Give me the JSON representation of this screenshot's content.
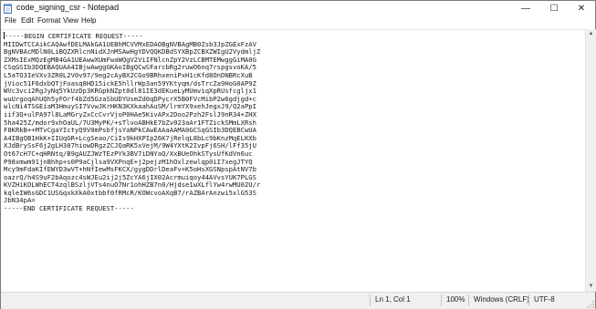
{
  "window": {
    "title": "code_signing_csr - Notepad",
    "controls": {
      "minimize_glyph": "—",
      "maximize_glyph": "☐",
      "close_glyph": "✕"
    }
  },
  "menu": {
    "items": [
      "File",
      "Edit",
      "Format",
      "View",
      "Help"
    ]
  },
  "editor": {
    "lines": [
      "-----BEGIN CERTIFICATE REQUEST-----",
      "MIIDwTCCAikCAQAwfDELMAkGA1UEBhMCVVMxEDAOBgNVBAgMB0Zsb3JpZGExFzAV",
      "BgNVBAcMDlN0LiBQZXRlcnNidXJnMSAwHgYDVQQKDBdSYXBpZCBXZWIgU2VydmljZ",
      "ZXMsIExMQzEgMB4GA1UEAwwXUmFwaWQgV2ViIFNlcnZpY2VzLCBMTEMwggGiMA0G",
      "CSqGSIb3DQEBAQUAA4IBjwAwggGKAoIBgQCwSFarcbRg2ruwO6nq7rspgsvoKA/5",
      "L5aTO3IeVXv3ZR0L2V0v97/9eg2cAyBX2CGo9BRhxeniPxH1cKfd8OnDNBRcXuB",
      "jVioc51F6dxbQTjFoasq8HD15ickE5hllrWp3an59YKtyqm/dsTrcZa9HoG0AP9Z",
      "WVc3vci2RgJyNq5YkUzDp3KRGpkNZpt0dl81IE3dEKueLyMUmviqXpRUsfcgljx1",
      "wuUrgoqAhUQh5yFOrf4bZd5GzaSbUDYUsmZd0qDPycrX5B0FVcMibP2w6gdjgd+c",
      "wlcNi4TSGEiaM3HmuySI7VvwJKrHKN3KXkaahAuSM/lrmYX9xehJegxJ9/Q2aPpI",
      "iif3Q+ulPA97l8LaMGryZxCcCvrVjoP0HAe5KivAPx2Doo2Pzh2FslJ9nR34+ZHX",
      "5ha425Z/mdor9xhOaUL/7U3MyPK/+sTlvoABHkE7bZv023aAr1FTZickSMmLXRsh",
      "F8KRkB++MTvCgaYIctyQ9V0mPsbfjsYaNPkCAwEAAaAAMA0GCSqGSIb3DQEBCwUA",
      "A4IBgQB1HkK+IIUqGR+LcgSeao/CiIs9kHXPIp26K7jRelqL8bLc9bKnzMqELKXb",
      "XJdBrySsF6j2gLH307hiowDRgzZCJQaRK5xVejM/9W4YXtK2IvpFj6SH/lFf35jU",
      "Ot67cH7C+qHRNtq/B9gAUZJWzTEzPYk3BV7iDNYaQ/XxBUeOhkSTysUfKdVn6uc",
      "P98xmwm91jnBhhp+s0P9aCjlsa9VXPnqE+j2pejzM1hOxlzewlqp0iI7xegJTYQ",
      "Mcy9mFdaKIfEWYD3wVT+hNfIewMsFKCX/gygDDrlDeaFv+K5oHsXGSNpspAtNV7b",
      "oazrQ/h4S9uF2bAqozc4sWJEu2ij2j5ZcYA6jIX02Acrmuiqoy44AVvsYUK7PLGS",
      "KVZHiKOLWhECT4zqlBSzljVTs4nuO7Nr1ohHZB7n0/Hjdse1wXLflYw4rwMU02U/r",
      "kqleIW6sGDC1USGqxkXkA0xtbbf0fRMcR/KOWcvoAXqB7/rAZBArAnzwi5xlG53S",
      "JbN34pA=",
      "-----END CERTIFICATE REQUEST-----"
    ]
  },
  "statusbar": {
    "position": "Ln 1, Col 1",
    "zoom": "100%",
    "line_ending": "Windows (CRLF)",
    "encoding": "UTF-8"
  }
}
